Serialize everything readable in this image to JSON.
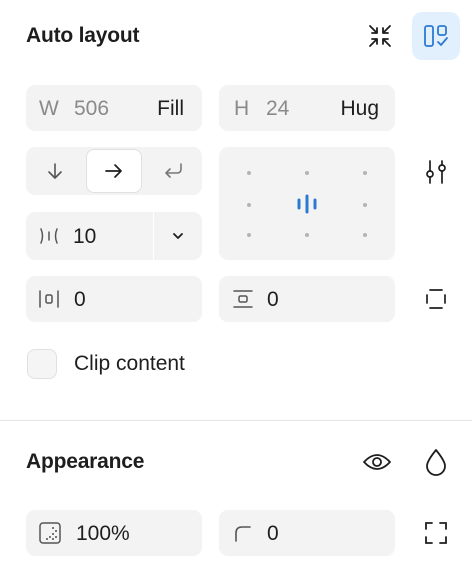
{
  "auto_layout": {
    "title": "Auto layout",
    "width": {
      "letter": "W",
      "value": "506",
      "mode": "Fill"
    },
    "height": {
      "letter": "H",
      "value": "24",
      "mode": "Hug"
    },
    "direction_selected": "horizontal",
    "gap": {
      "value": "10"
    },
    "horizontal_padding": {
      "value": "0"
    },
    "vertical_padding": {
      "value": "0"
    },
    "clip_content_label": "Clip content",
    "clip_content_checked": false
  },
  "appearance": {
    "title": "Appearance",
    "opacity": {
      "value": "100%"
    },
    "corner_radius": {
      "value": "0"
    }
  },
  "colors": {
    "accent": "#2c7ad3",
    "active_bg": "#e2f0fd",
    "field_bg": "#f3f3f3"
  }
}
